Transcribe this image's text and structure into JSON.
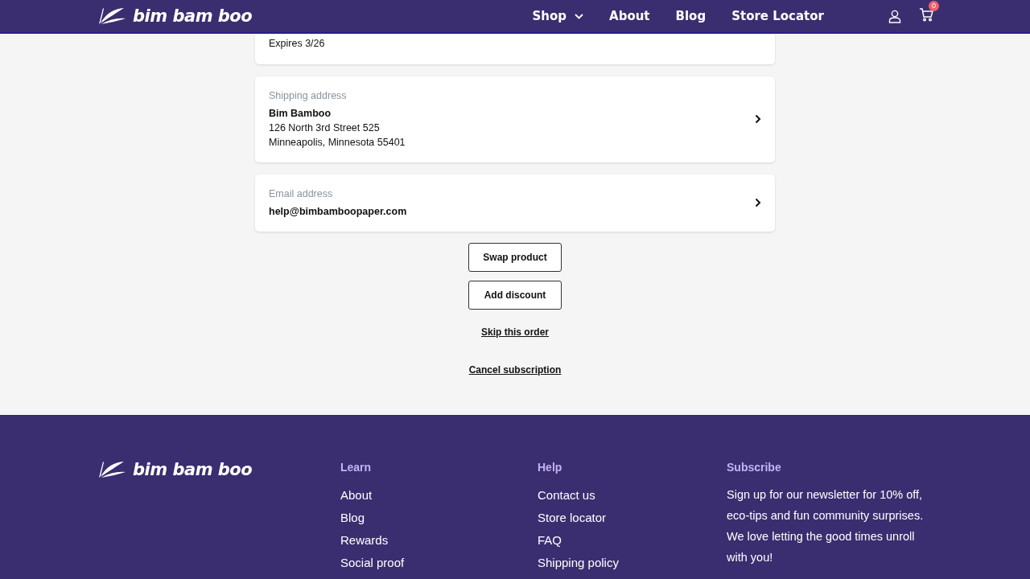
{
  "header": {
    "logo": "bim bam boo",
    "nav": [
      {
        "label": "Shop",
        "dropdown": true
      },
      {
        "label": "About",
        "dropdown": false
      },
      {
        "label": "Blog",
        "dropdown": false
      },
      {
        "label": "Store Locator",
        "dropdown": false
      }
    ],
    "cart_count": "0"
  },
  "cards": [
    {
      "kind": "partial",
      "lines": [
        "Expires 3/26"
      ],
      "chevron": false
    },
    {
      "kind": "detail",
      "label": "Shipping address",
      "title": "Bim Bamboo",
      "lines": [
        "126 North 3rd Street 525",
        "Minneapolis, Minnesota 55401"
      ],
      "chevron": true
    },
    {
      "kind": "detail",
      "label": "Email address",
      "title": "help@bimbamboopaper.com",
      "chevron": true
    }
  ],
  "actions": [
    {
      "label": "Swap product",
      "kind": "outlined"
    },
    {
      "label": "Add discount",
      "kind": "outlined"
    },
    {
      "label": "Skip this order",
      "kind": "link"
    },
    {
      "label": "Cancel subscription",
      "kind": "link"
    }
  ],
  "footer": {
    "logo": "bim bam boo",
    "columns": [
      {
        "heading": "Learn",
        "links": [
          "About",
          "Blog",
          "Rewards",
          "Social proof"
        ]
      },
      {
        "heading": "Help",
        "links": [
          "Contact us",
          "Store locator",
          "FAQ",
          "Shipping policy"
        ]
      }
    ],
    "subscribe": {
      "heading": "Subscribe",
      "text": "Sign up for our newsletter for 10% off, eco-tips and fun community surprises. We love letting the good times unroll with you!"
    }
  }
}
